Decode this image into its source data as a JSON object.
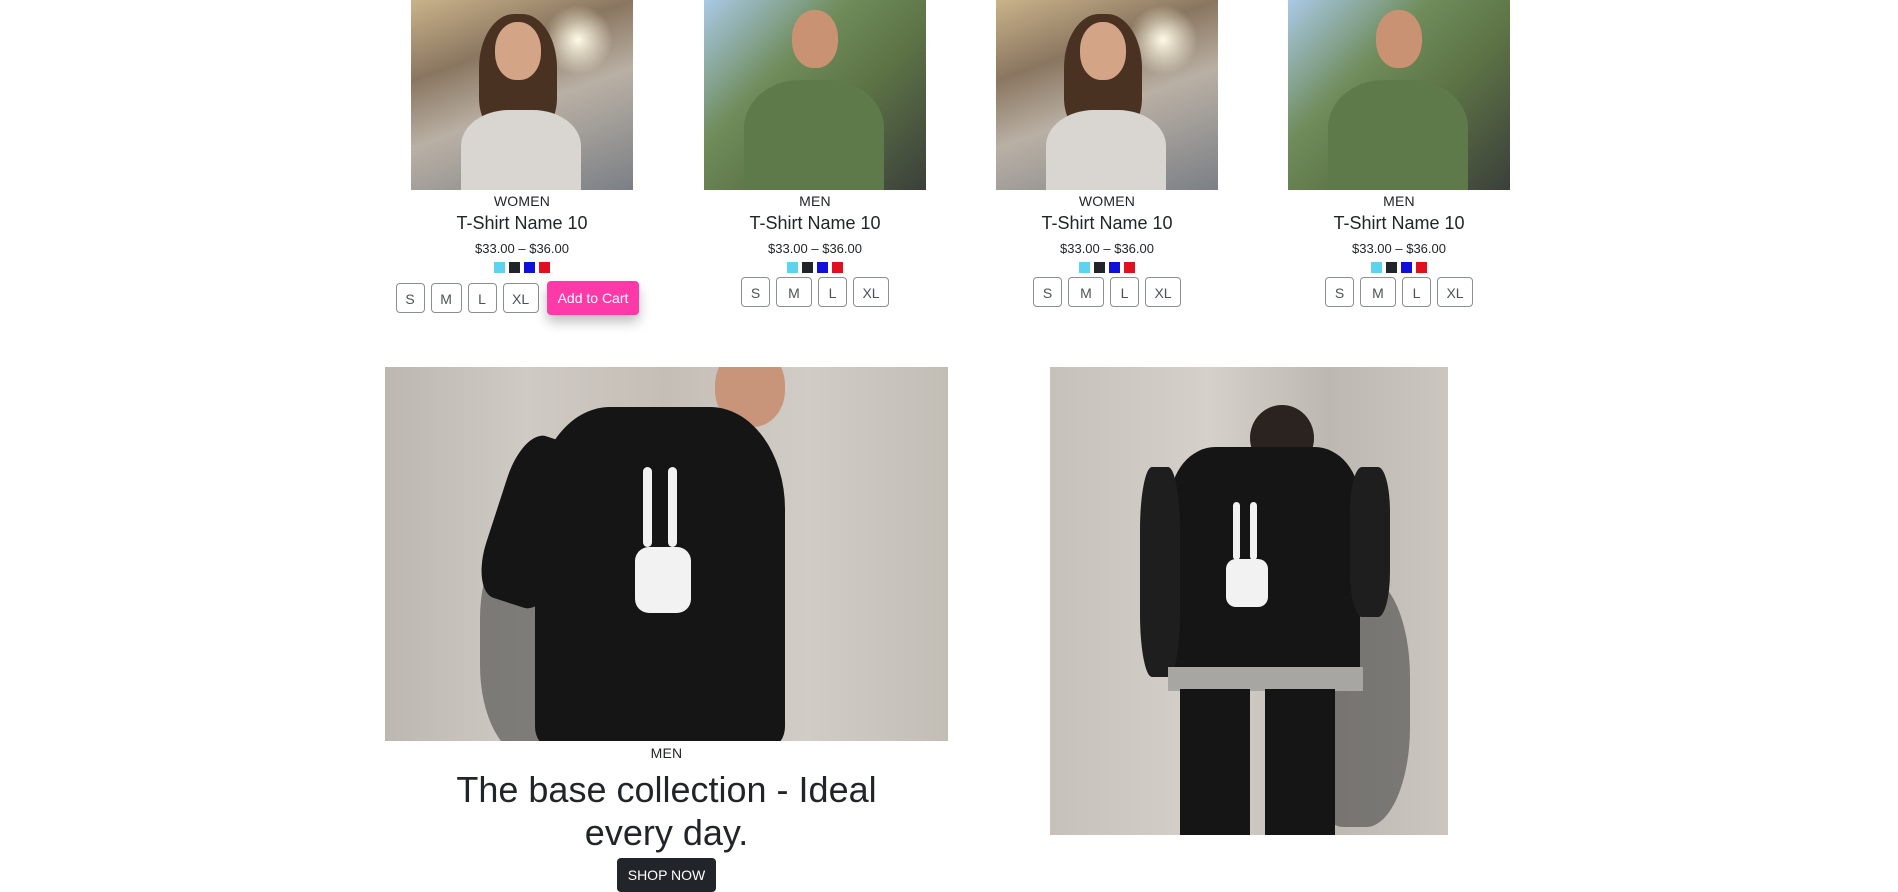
{
  "products": [
    {
      "category": "WOMEN",
      "name": "T-Shirt Name 10",
      "price": "$33.00 – $36.00",
      "image": "woman-sunglasses-photo",
      "show_cart": true
    },
    {
      "category": "MEN",
      "name": "T-Shirt Name 10",
      "price": "$33.00 – $36.00",
      "image": "man-green-tee-photo",
      "show_cart": false
    },
    {
      "category": "WOMEN",
      "name": "T-Shirt Name 10",
      "price": "$33.00 – $36.00",
      "image": "woman-sunglasses-photo",
      "show_cart": false
    },
    {
      "category": "MEN",
      "name": "T-Shirt Name 10",
      "price": "$33.00 – $36.00",
      "image": "man-green-tee-photo",
      "show_cart": false
    }
  ],
  "swatch_colors": [
    "#5ed3f0",
    "#212529",
    "#1010d8",
    "#e01020"
  ],
  "sizes": [
    "S",
    "M",
    "L",
    "XL"
  ],
  "add_to_cart_label": "Add to Cart",
  "colors": {
    "accent_pink": "#ff3aa8",
    "dark": "#212529"
  },
  "banner": {
    "category": "MEN",
    "title": "The base collection - Ideal every day.",
    "button_label": "SHOP NOW",
    "image_left": "man-skeleton-tee-photo",
    "image_right": "man-skeleton-tee-full-photo"
  }
}
